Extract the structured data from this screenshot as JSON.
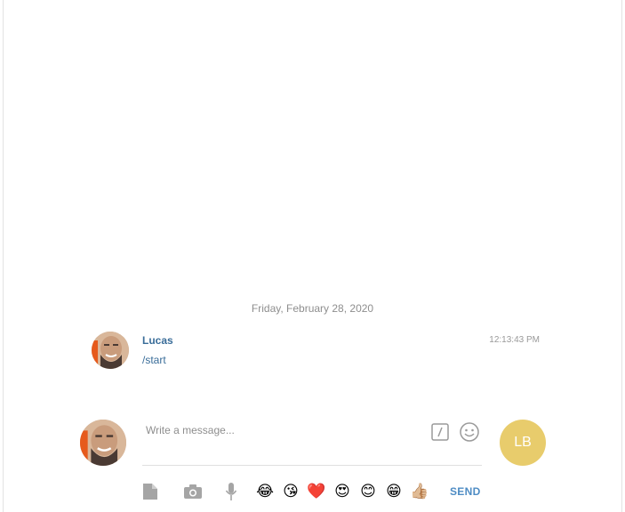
{
  "chat": {
    "date_separator": "Friday, February 28, 2020",
    "messages": [
      {
        "author": "Lucas",
        "text": "/start",
        "time": "12:13:43 PM"
      }
    ]
  },
  "composer": {
    "placeholder": "Write a message...",
    "user_initials": "LB",
    "send_label": "SEND",
    "emojis": [
      "😂",
      "😘",
      "❤️",
      "😍",
      "😊",
      "😁",
      "👍🏼"
    ],
    "user_avatar_color": "#e8cc6c"
  }
}
